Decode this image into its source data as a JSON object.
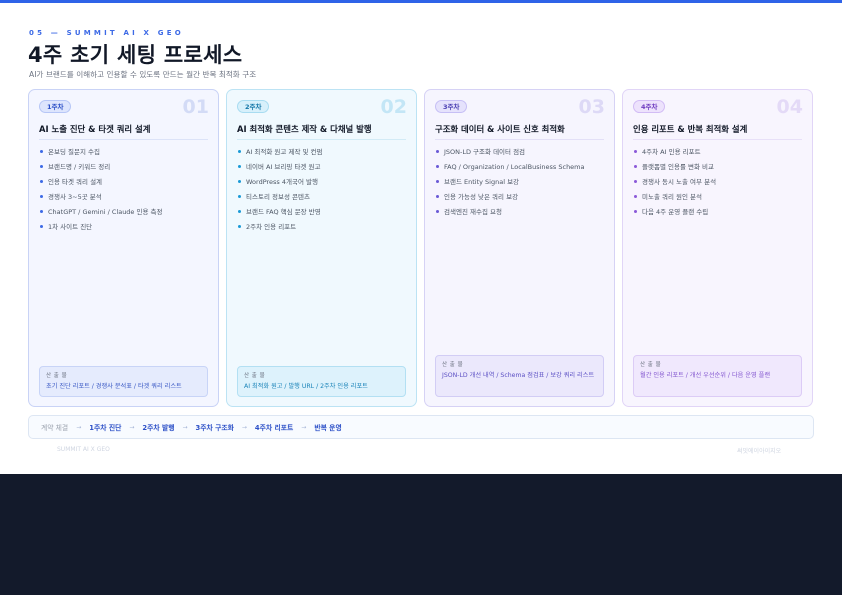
{
  "slide": {
    "eyebrow": "05 — SUMMIT AI X GEO",
    "title": "4주 초기 세팅 프로세스",
    "subtitle": "AI가 브랜드를 이해하고 인용할 수 있도록 만드는 월간 반복 최적화 구조"
  },
  "cards": [
    {
      "badge": "1주차",
      "number": "01",
      "title": "AI 노출 진단 & 타겟 쿼리 설계",
      "items": [
        "온보딩 질문지 수집",
        "브랜드명 / 키워드 정리",
        "인용 타겟 쿼리 설계",
        "경쟁사 3~5곳 분석",
        "ChatGPT / Gemini / Claude 인용 측정",
        "1차 사이트 진단"
      ],
      "output_label": "산 출 물",
      "output_text": "초기 진단 리포트 / 경쟁사 분석표 / 타겟 쿼리 리스트"
    },
    {
      "badge": "2주차",
      "number": "02",
      "title": "AI 최적화 콘텐츠 제작 & 다채널 발행",
      "items": [
        "AI 최적화 원고 제작 및 컨펌",
        "네이버 AI 브리핑 타겟 원고",
        "WordPress 4개국어 발행",
        "티스토리 정보성 콘텐츠",
        "브랜드 FAQ 핵심 문장 반영",
        "2주차 인용 리포트"
      ],
      "output_label": "산 출 물",
      "output_text": "AI 최적화 원고 / 발행 URL / 2주차 인용 리포트"
    },
    {
      "badge": "3주차",
      "number": "03",
      "title": "구조화 데이터 & 사이트 신호 최적화",
      "items": [
        "JSON-LD 구조화 데이터 점검",
        "FAQ / Organization / LocalBusiness Schema",
        "브랜드 Entity Signal 보강",
        "인용 가능성 낮은 쿼리 보강",
        "검색엔진 재수집 요청"
      ],
      "output_label": "산 출 물",
      "output_text": "JSON-LD 개선 내역 / Schema 점검표 / 보강 쿼리 리스트"
    },
    {
      "badge": "4주차",
      "number": "04",
      "title": "인용 리포트 & 반복 최적화 설계",
      "items": [
        "4주차 AI 인용 리포트",
        "플랫폼별 인용률 변화 비교",
        "경쟁사 동시 노출 여부 분석",
        "미노출 쿼리 원인 분석",
        "다음 4주 운영 플랜 수립"
      ],
      "output_label": "산 출 물",
      "output_text": "월간 인용 리포트 / 개선 우선순위 / 다음 운영 플랜"
    }
  ],
  "flow": {
    "start": "계약 체결",
    "arrow": "→",
    "steps": [
      "1주차 진단",
      "2주차 발행",
      "3주차 구조화",
      "4주차 리포트",
      "반복 운영"
    ]
  },
  "footer": {
    "left": "SUMMIT AI X GEO",
    "right": "써밋에이아이지오"
  },
  "colors": {
    "accent": "#2f63e8",
    "week1": "#3d6ae6",
    "week2": "#1b9ad6",
    "week3": "#6a5ad6",
    "week4": "#8b5ad9",
    "lower_panel": "#131a2b"
  }
}
